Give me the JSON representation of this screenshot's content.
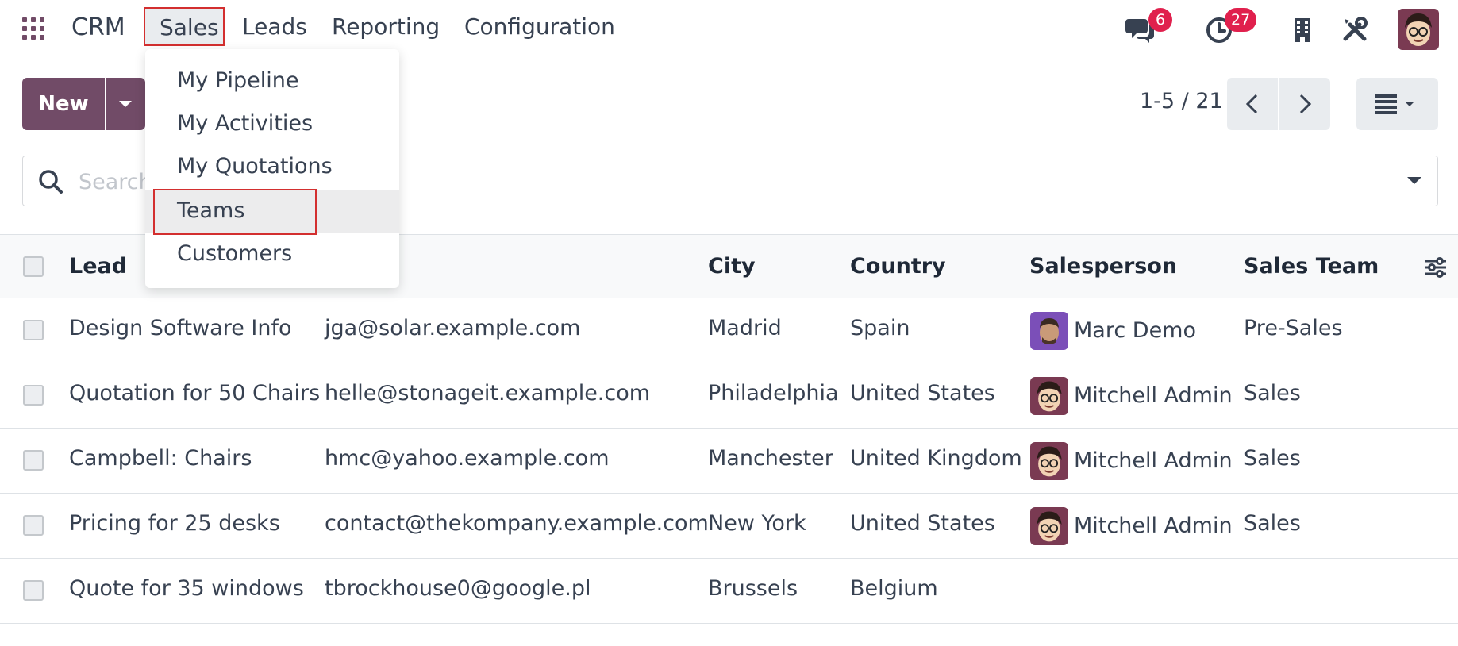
{
  "colors": {
    "brand": "#714B67",
    "badge": "#e0204d",
    "highlight": "#d32f2f"
  },
  "topbar": {
    "app_name": "CRM",
    "menu": [
      "Sales",
      "Leads",
      "Reporting",
      "Configuration"
    ],
    "messages_badge": "6",
    "activities_badge": "27"
  },
  "sales_menu": {
    "items": [
      "My Pipeline",
      "My Activities",
      "My Quotations",
      "Teams",
      "Customers"
    ]
  },
  "control": {
    "new_label": "New",
    "pager": "1-5 / 21"
  },
  "search": {
    "placeholder": "Search..."
  },
  "table": {
    "columns": {
      "lead": "Lead",
      "city": "City",
      "country": "Country",
      "salesperson": "Salesperson",
      "team": "Sales Team"
    },
    "rows": [
      {
        "lead": "Design Software Info",
        "email": "jga@solar.example.com",
        "city": "Madrid",
        "country": "Spain",
        "salesperson": "Marc Demo",
        "team": "Pre-Sales"
      },
      {
        "lead": "Quotation for 50 Chairs",
        "email": "helle@stonageit.example.com",
        "city": "Philadelphia",
        "country": "United States",
        "salesperson": "Mitchell Admin",
        "team": "Sales"
      },
      {
        "lead": "Campbell: Chairs",
        "email": "hmc@yahoo.example.com",
        "city": "Manchester",
        "country": "United Kingdom",
        "salesperson": "Mitchell Admin",
        "team": "Sales"
      },
      {
        "lead": "Pricing for 25 desks",
        "email": "contact@thekompany.example.com",
        "city": "New York",
        "country": "United States",
        "salesperson": "Mitchell Admin",
        "team": "Sales"
      },
      {
        "lead": "Quote for 35 windows",
        "email": "tbrockhouse0@google.pl",
        "city": "Brussels",
        "country": "Belgium",
        "salesperson": "",
        "team": ""
      }
    ]
  }
}
